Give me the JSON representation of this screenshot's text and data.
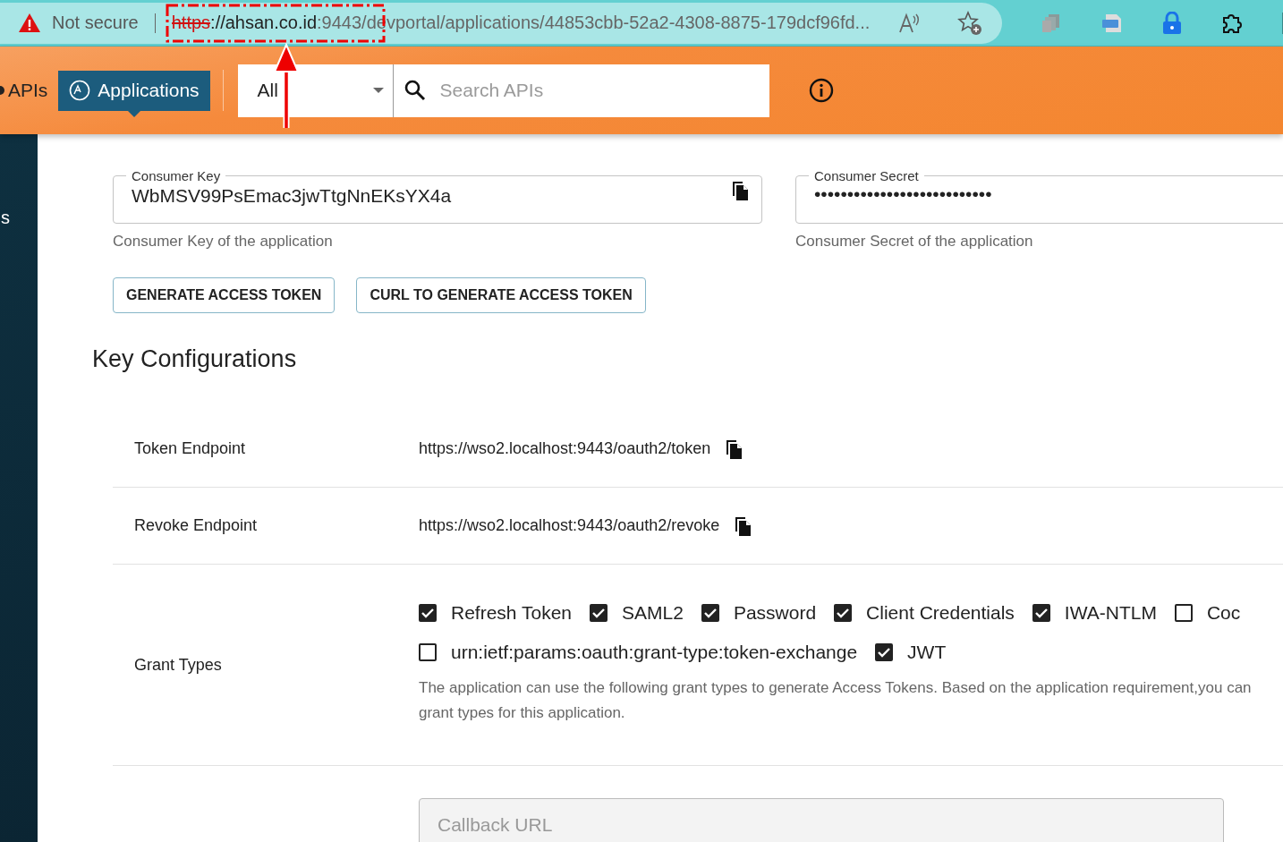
{
  "browser": {
    "security": "Not secure",
    "url_scheme": "https",
    "url_host": "://ahsan.co.id",
    "url_rest": ":9443/devportal/applications/44853cbb-52a2-4308-8875-179dcf96fd..."
  },
  "nav": {
    "items": [
      {
        "label": "APIs",
        "selected": false
      },
      {
        "label": "Applications",
        "selected": true
      }
    ],
    "filter": "All",
    "search_placeholder": "Search APIs"
  },
  "sidebar": {
    "text": "s"
  },
  "credentials": [
    {
      "label": "Consumer Key",
      "value": "WbMSV99PsEmac3jwTtgNnEKsYX4a",
      "helper": "Consumer Key of the application",
      "copyable": true
    },
    {
      "label": "Consumer Secret",
      "value": "•••••••••••••••••••••••••••",
      "helper": "Consumer Secret of the application",
      "copyable": false
    }
  ],
  "buttons": [
    "GENERATE ACCESS TOKEN",
    "CURL TO GENERATE ACCESS TOKEN"
  ],
  "section_title": "Key Configurations",
  "endpoints": [
    {
      "label": "Token Endpoint",
      "value": "https://wso2.localhost:9443/oauth2/token"
    },
    {
      "label": "Revoke Endpoint",
      "value": "https://wso2.localhost:9443/oauth2/revoke"
    }
  ],
  "grant_types": {
    "label": "Grant Types",
    "options": [
      {
        "label": "Refresh Token",
        "checked": true
      },
      {
        "label": "SAML2",
        "checked": true
      },
      {
        "label": "Password",
        "checked": true
      },
      {
        "label": "Client Credentials",
        "checked": true
      },
      {
        "label": "IWA-NTLM",
        "checked": true
      },
      {
        "label": "Coc",
        "checked": false
      },
      {
        "label": "urn:ietf:params:oauth:grant-type:token-exchange",
        "checked": false
      },
      {
        "label": "JWT",
        "checked": true
      }
    ],
    "description_lines": [
      "The application can use the following grant types to generate Access Tokens. Based on the application requirement,you can",
      "grant types for this application."
    ]
  },
  "callback": {
    "placeholder": "Callback URL"
  }
}
